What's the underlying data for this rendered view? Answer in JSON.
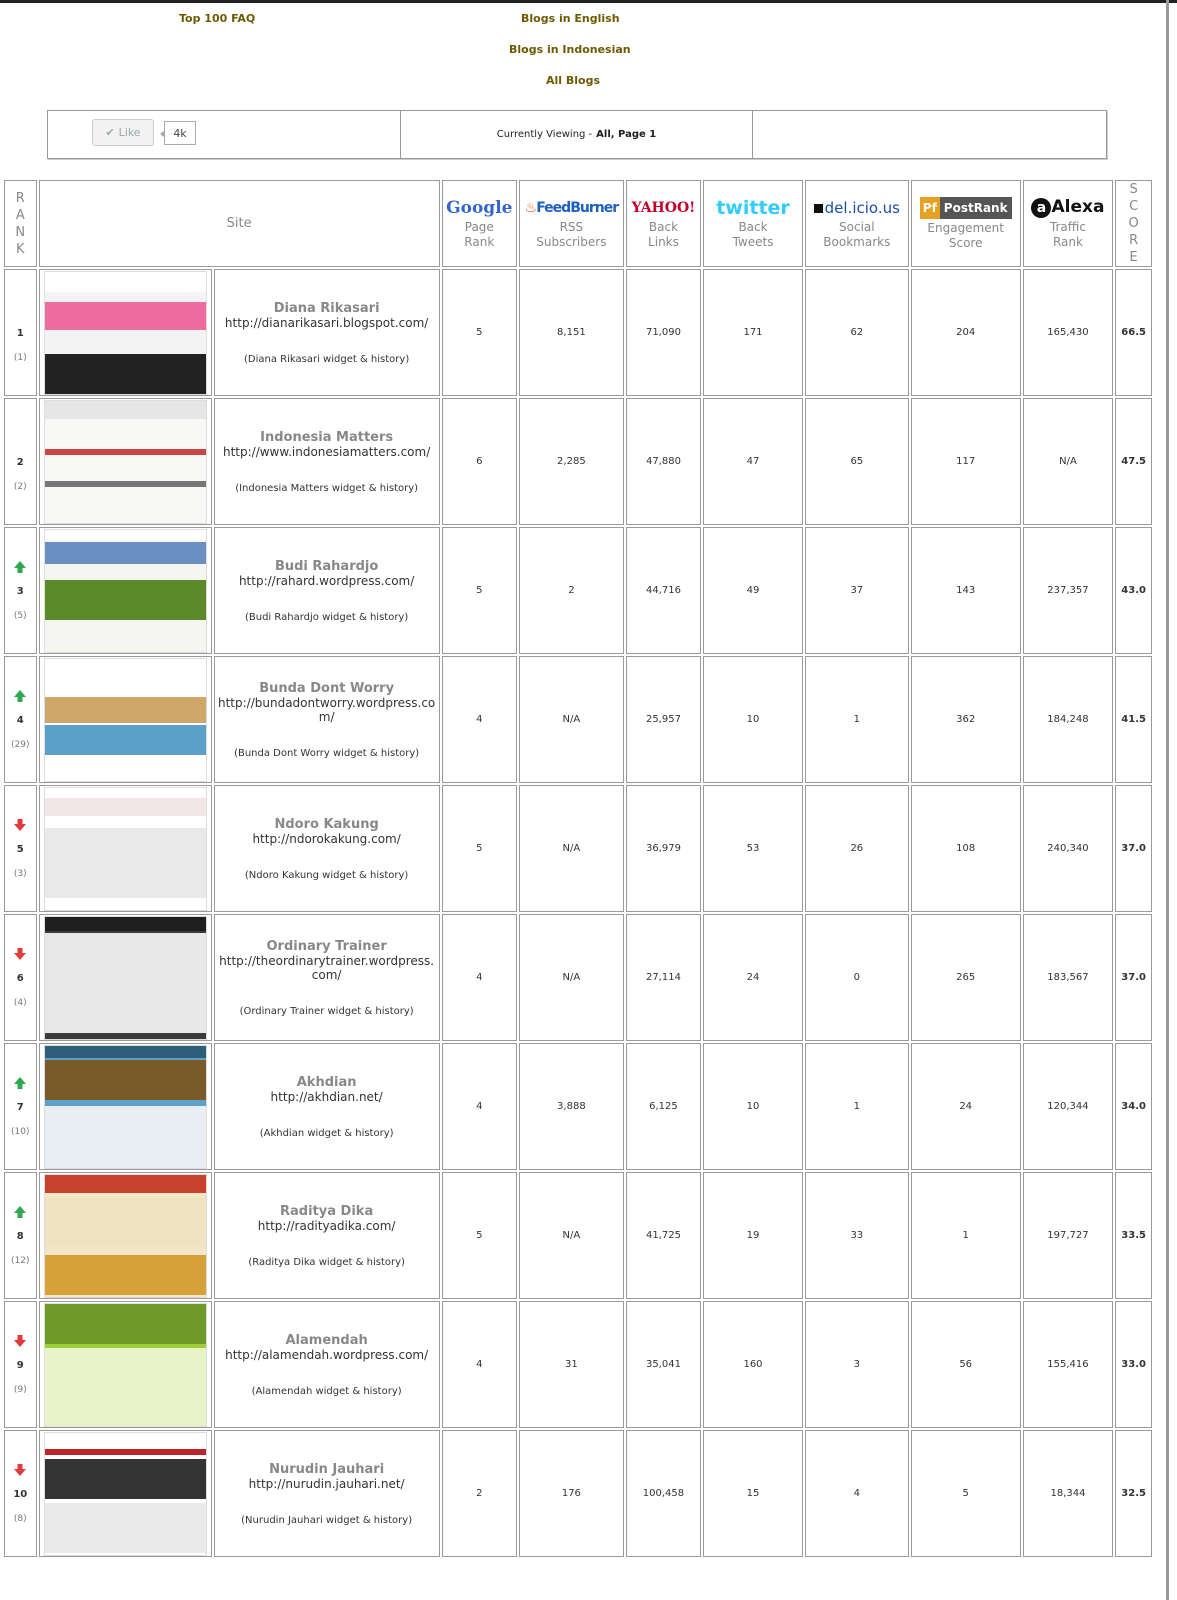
{
  "nav": {
    "faq": "Top 100 FAQ",
    "english": "Blogs in English",
    "indonesian": "Blogs in Indonesian",
    "all": "All Blogs"
  },
  "infobar": {
    "like_label": "Like",
    "like_count": "4k",
    "viewing_prefix": "Currently Viewing -",
    "viewing_value": "All, Page 1"
  },
  "table": {
    "headers": {
      "rank_letters": [
        "R",
        "A",
        "N",
        "K"
      ],
      "site": "Site",
      "score_letters": [
        "S",
        "C",
        "O",
        "R",
        "E"
      ],
      "google": {
        "logo": "Google",
        "sub1": "Page",
        "sub2": "Rank"
      },
      "feedburner": {
        "logo": "FeedBurner",
        "sub1": "RSS",
        "sub2": "Subscribers"
      },
      "yahoo": {
        "logo": "YAHOO!",
        "sub1": "Back",
        "sub2": "Links"
      },
      "twitter": {
        "logo": "twitter",
        "sub1": "Back",
        "sub2": "Tweets"
      },
      "delicious": {
        "logo": "del.icio.us",
        "sub1": "Social",
        "sub2": "Bookmarks"
      },
      "postrank": {
        "logo": "PostRank",
        "sub1": "Engagement",
        "sub2": "Score"
      },
      "alexa": {
        "logo": "Alexa",
        "sub1": "Traffic",
        "sub2": "Rank"
      }
    },
    "colors": {
      "up": "#2fa84f",
      "down": "#e23b3b",
      "logo_google": "#3366cc",
      "logo_feedburner": "#1f5fbf",
      "logo_yahoo": "#c1002a",
      "logo_twitter": "#33ccff",
      "logo_delicious": "#1b4fa0",
      "logo_postrank": "#555555",
      "logo_alexa": "#111111"
    },
    "rows": [
      {
        "rank": "1",
        "prev": "(1)",
        "trend": "none",
        "name": "Diana Rikasari",
        "url": "http://dianarikasari.blogspot.com/",
        "widget": "(Diana Rikasari widget & history)",
        "pagerank": "5",
        "rss": "8,151",
        "backlinks": "71,090",
        "tweets": "171",
        "bookmarks": "62",
        "engagement": "204",
        "traffic": "165,430",
        "score": "66.5"
      },
      {
        "rank": "2",
        "prev": "(2)",
        "trend": "none",
        "name": "Indonesia Matters",
        "url": "http://www.indonesiamatters.com/",
        "widget": "(Indonesia Matters widget & history)",
        "pagerank": "6",
        "rss": "2,285",
        "backlinks": "47,880",
        "tweets": "47",
        "bookmarks": "65",
        "engagement": "117",
        "traffic": "N/A",
        "score": "47.5"
      },
      {
        "rank": "3",
        "prev": "(5)",
        "trend": "up",
        "name": "Budi Rahardjo",
        "url": "http://rahard.wordpress.com/",
        "widget": "(Budi Rahardjo widget & history)",
        "pagerank": "5",
        "rss": "2",
        "backlinks": "44,716",
        "tweets": "49",
        "bookmarks": "37",
        "engagement": "143",
        "traffic": "237,357",
        "score": "43.0"
      },
      {
        "rank": "4",
        "prev": "(29)",
        "trend": "up",
        "name": "Bunda Dont Worry",
        "url": "http://bundadontworry.wordpress.com/",
        "widget": "(Bunda Dont Worry widget & history)",
        "pagerank": "4",
        "rss": "N/A",
        "backlinks": "25,957",
        "tweets": "10",
        "bookmarks": "1",
        "engagement": "362",
        "traffic": "184,248",
        "score": "41.5"
      },
      {
        "rank": "5",
        "prev": "(3)",
        "trend": "down",
        "name": "Ndoro Kakung",
        "url": "http://ndorokakung.com/",
        "widget": "(Ndoro Kakung widget & history)",
        "pagerank": "5",
        "rss": "N/A",
        "backlinks": "36,979",
        "tweets": "53",
        "bookmarks": "26",
        "engagement": "108",
        "traffic": "240,340",
        "score": "37.0"
      },
      {
        "rank": "6",
        "prev": "(4)",
        "trend": "down",
        "name": "Ordinary Trainer",
        "url": "http://theordinarytrainer.wordpress.com/",
        "widget": "(Ordinary Trainer widget & history)",
        "pagerank": "4",
        "rss": "N/A",
        "backlinks": "27,114",
        "tweets": "24",
        "bookmarks": "0",
        "engagement": "265",
        "traffic": "183,567",
        "score": "37.0"
      },
      {
        "rank": "7",
        "prev": "(10)",
        "trend": "up",
        "name": "Akhdian",
        "url": "http://akhdian.net/",
        "widget": "(Akhdian widget & history)",
        "pagerank": "4",
        "rss": "3,888",
        "backlinks": "6,125",
        "tweets": "10",
        "bookmarks": "1",
        "engagement": "24",
        "traffic": "120,344",
        "score": "34.0"
      },
      {
        "rank": "8",
        "prev": "(12)",
        "trend": "up",
        "name": "Raditya Dika",
        "url": "http://radityadika.com/",
        "widget": "(Raditya Dika widget & history)",
        "pagerank": "5",
        "rss": "N/A",
        "backlinks": "41,725",
        "tweets": "19",
        "bookmarks": "33",
        "engagement": "1",
        "traffic": "197,727",
        "score": "33.5"
      },
      {
        "rank": "9",
        "prev": "(9)",
        "trend": "down",
        "name": "Alamendah",
        "url": "http://alamendah.wordpress.com/",
        "widget": "(Alamendah widget & history)",
        "pagerank": "4",
        "rss": "31",
        "backlinks": "35,041",
        "tweets": "160",
        "bookmarks": "3",
        "engagement": "56",
        "traffic": "155,416",
        "score": "33.0"
      },
      {
        "rank": "10",
        "prev": "(8)",
        "trend": "down",
        "name": "Nurudin Jauhari",
        "url": "http://nurudin.jauhari.net/",
        "widget": "(Nurudin Jauhari widget & history)",
        "pagerank": "2",
        "rss": "176",
        "backlinks": "100,458",
        "tweets": "15",
        "bookmarks": "4",
        "engagement": "5",
        "traffic": "18,344",
        "score": "32.5"
      }
    ]
  }
}
